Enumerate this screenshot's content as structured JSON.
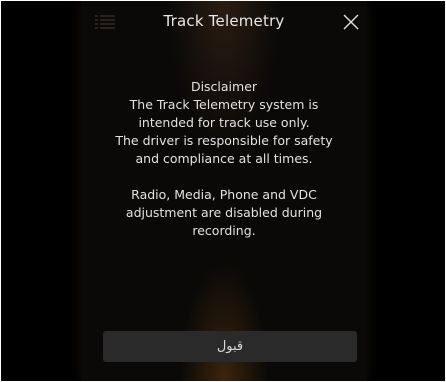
{
  "header": {
    "title": "Track Telemetry",
    "menu_icon": "menu-lines-icon",
    "close_icon": "close-x-icon"
  },
  "disclaimer": {
    "lines_para1": [
      "Disclaimer",
      "The Track Telemetry system is",
      "intended for track use only.",
      "The driver is responsible for safety",
      "and compliance at all times."
    ],
    "lines_para2": [
      "Radio, Media, Phone and VDC",
      "adjustment are disabled during",
      "recording."
    ]
  },
  "footer": {
    "accept_label": "قبول"
  },
  "colors": {
    "background": "#000000",
    "panel": "#0a0907",
    "text": "#e2e2e2",
    "button": "#2a2a2a"
  }
}
